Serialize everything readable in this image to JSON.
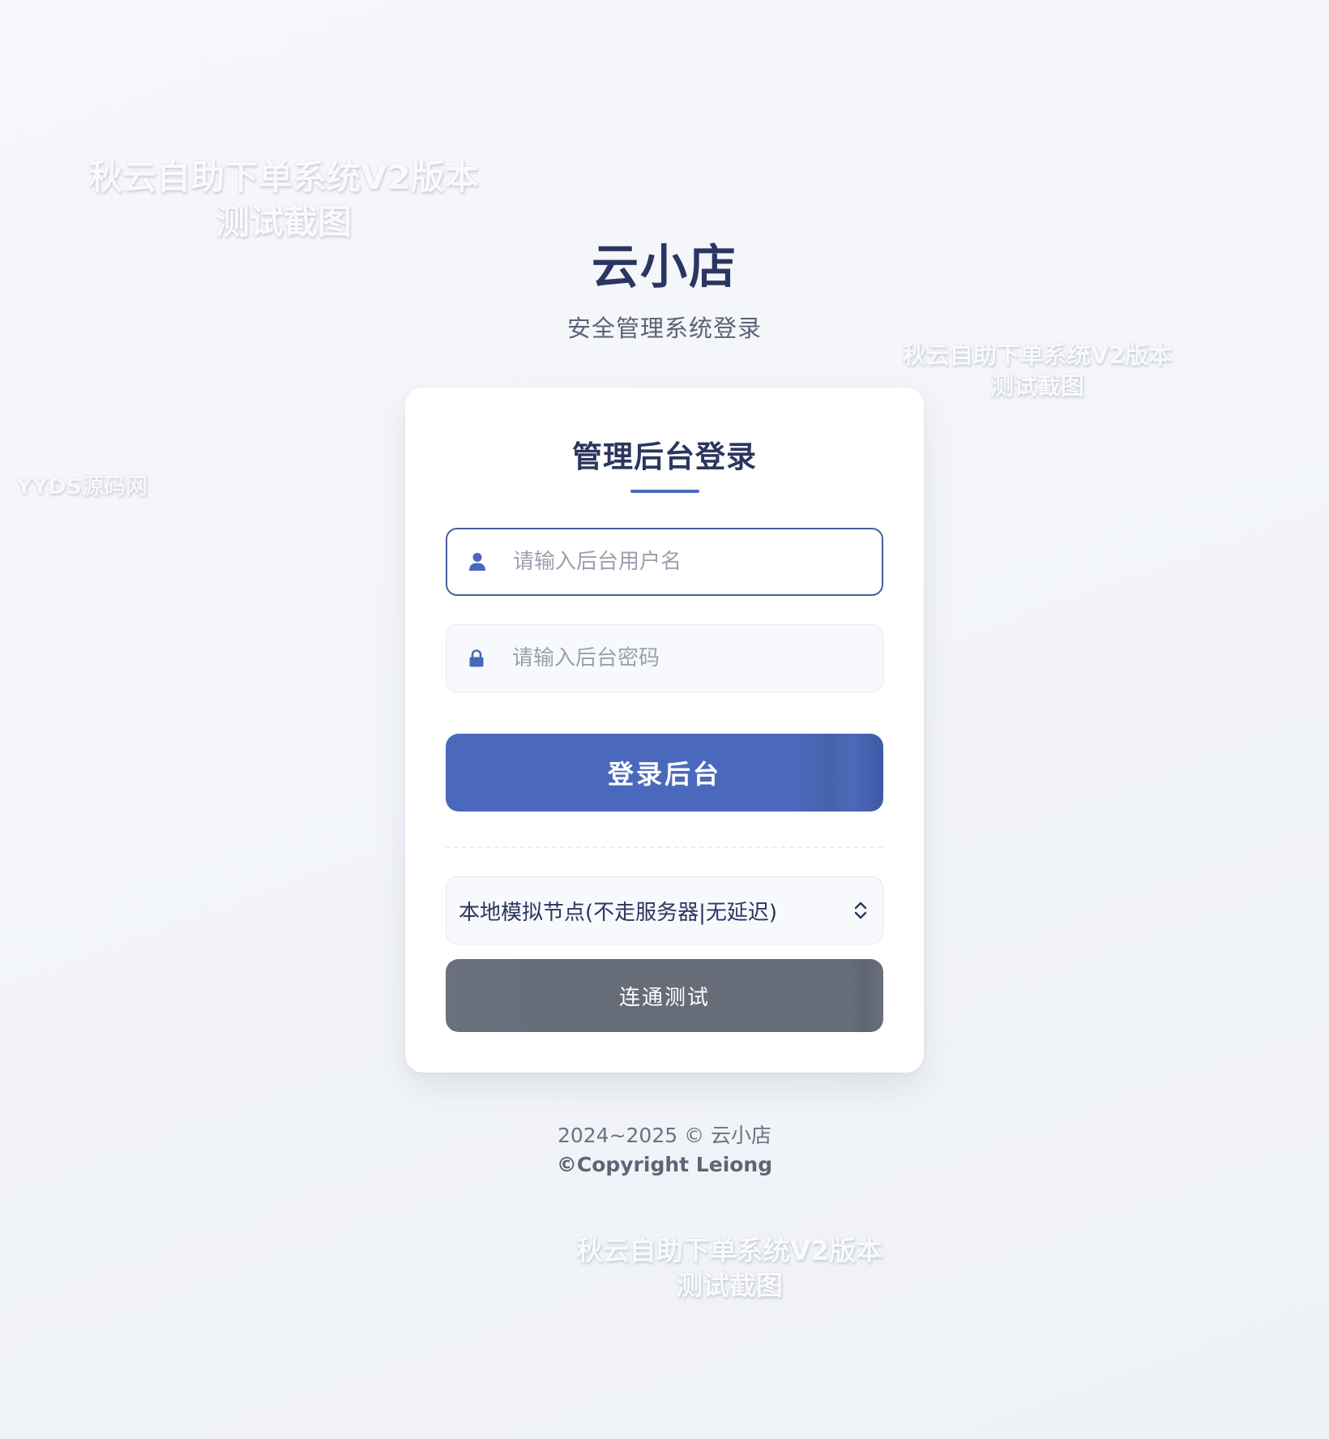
{
  "watermarks": {
    "top_left": {
      "line1": "秋云自助下单系统V2版本",
      "line2": "测试截图"
    },
    "right": {
      "line1": "秋云自助下单系统V2版本",
      "line2": "测试截图"
    },
    "bottom": {
      "line1": "秋云自助下单系统V2版本",
      "line2": "测试截图"
    },
    "site": "YYDS源码网"
  },
  "brand": {
    "name": "云小店",
    "subtitle": "安全管理系统登录"
  },
  "login_card": {
    "title": "管理后台登录",
    "accent_color": "#4a69bd",
    "username": {
      "icon": "user-icon",
      "value": "",
      "placeholder": "请输入后台用户名"
    },
    "password": {
      "icon": "lock-icon",
      "value": "",
      "placeholder": "请输入后台密码"
    },
    "login_button": "登录后台",
    "node_select": {
      "selected": "本地模拟节点(不走服务器|无延迟)",
      "icon": "chevron-up-down-icon"
    },
    "test_button": "连通测试",
    "test_button_color": "#666d78"
  },
  "footer": {
    "line1": "2024~2025 © 云小店",
    "line2": "©Copyright Leiong"
  }
}
